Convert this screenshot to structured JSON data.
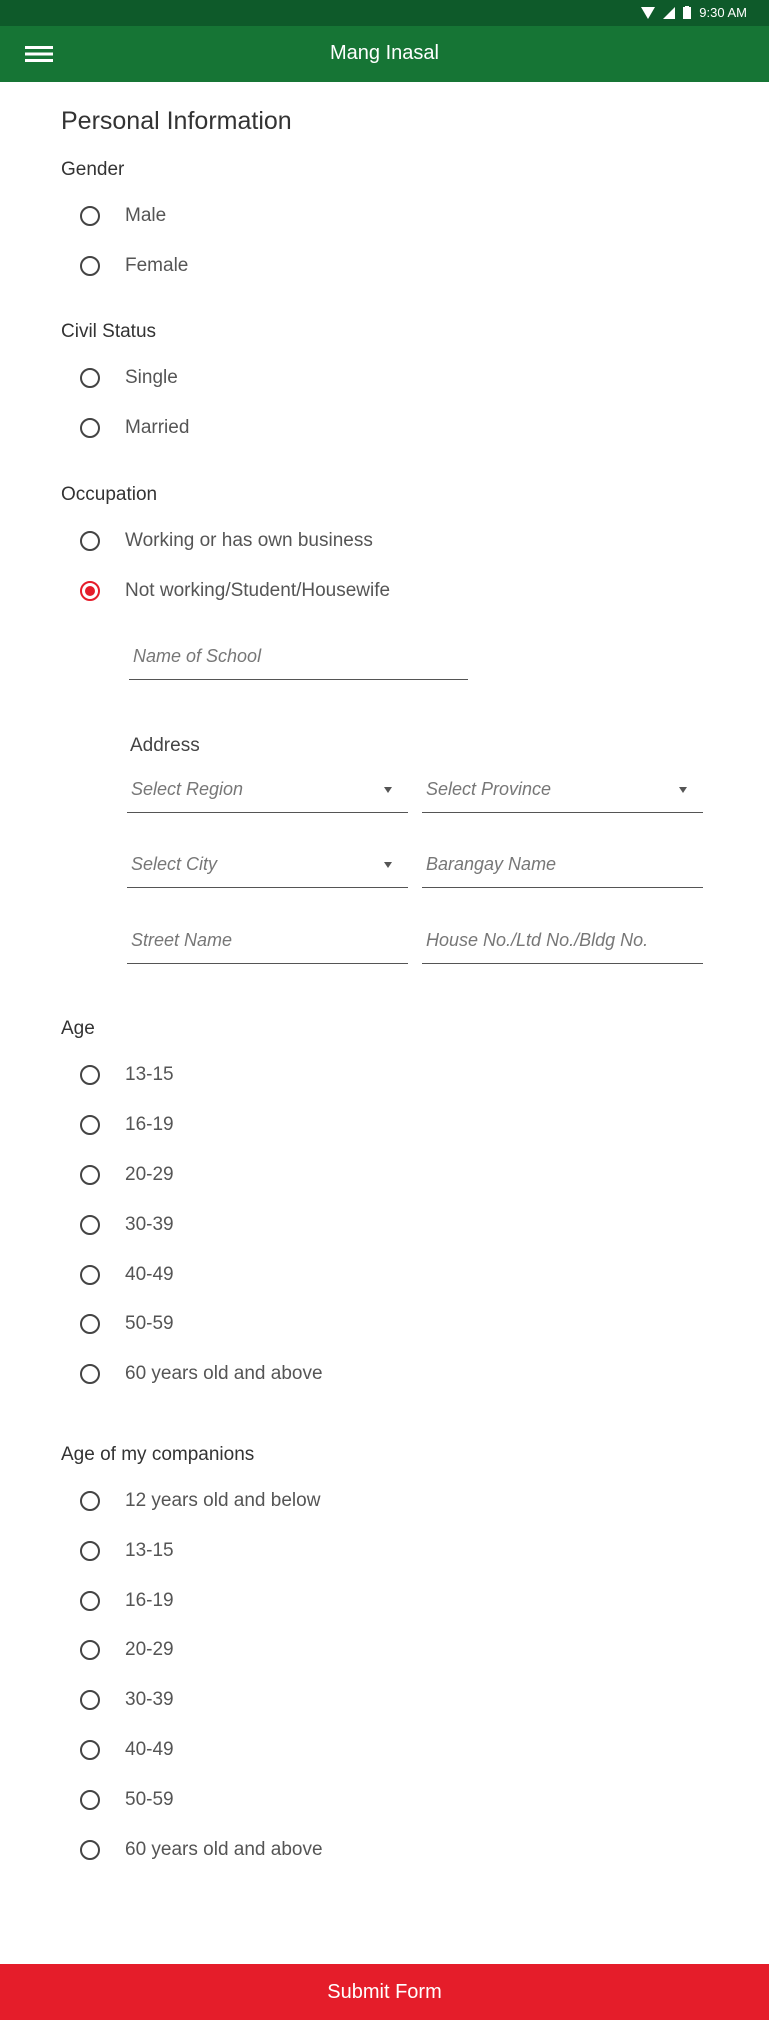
{
  "status_bar": {
    "time": "9:30 AM"
  },
  "app_bar": {
    "title": "Mang Inasal"
  },
  "form": {
    "section_title": "Personal Information",
    "gender": {
      "label": "Gender",
      "options": [
        "Male",
        "Female"
      ]
    },
    "civil_status": {
      "label": "Civil Status",
      "options": [
        "Single",
        "Married"
      ]
    },
    "occupation": {
      "label": "Occupation",
      "options": [
        "Working or has own business",
        "Not working/Student/Housewife"
      ],
      "selected": "Not working/Student/Housewife",
      "school_placeholder": "Name of School",
      "address_label": "Address",
      "region_placeholder": "Select Region",
      "province_placeholder": "Select Province",
      "city_placeholder": "Select City",
      "barangay_placeholder": "Barangay Name",
      "street_placeholder": "Street Name",
      "house_placeholder": "House No./Ltd No./Bldg No."
    },
    "age": {
      "label": "Age",
      "options": [
        "13-15",
        "16-19",
        "20-29",
        "30-39",
        "40-49",
        "50-59",
        "60 years old and above"
      ]
    },
    "companions": {
      "label": "Age of my companions",
      "options": [
        "12 years old and below",
        "13-15",
        "16-19",
        "20-29",
        "30-39",
        "40-49",
        "50-59",
        "60 years old and above"
      ]
    }
  },
  "submit_label": "Submit Form",
  "colors": {
    "app_bar": "#167535",
    "status_bar": "#0e5a2a",
    "accent": "#e51d2a"
  }
}
